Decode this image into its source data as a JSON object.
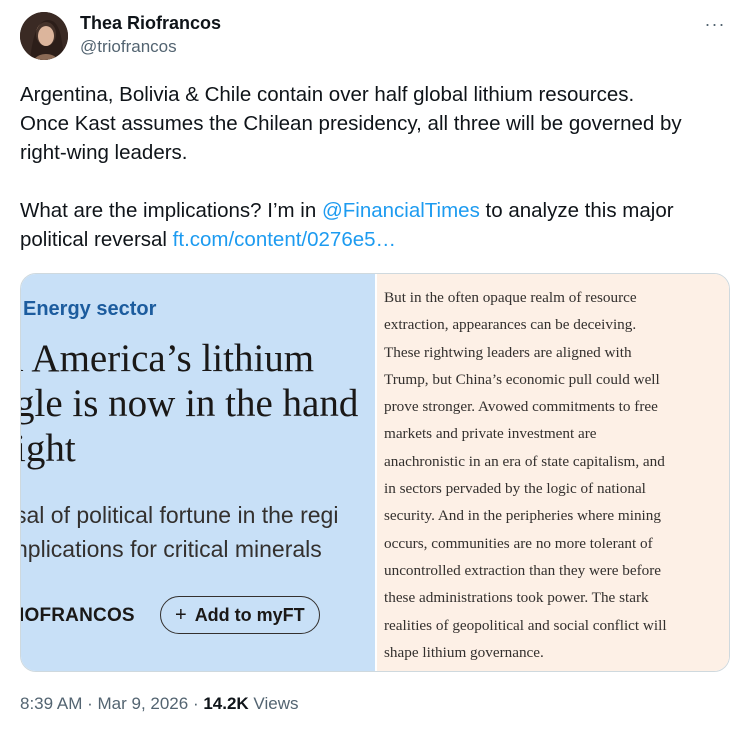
{
  "author": {
    "name": "Thea Riofrancos",
    "handle": "@triofrancos"
  },
  "more_icon": "···",
  "tweet": {
    "line1": "Argentina, Bolivia & Chile contain over half global lithium resources.",
    "line2": "Once Kast assumes the Chilean presidency, all three will be governed by",
    "line3": "right-wing leaders.",
    "line5_before": "What are the implications? I’m in ",
    "mention": "@FinancialTimes",
    "line5_after": " to analyze this major",
    "line6_before": "political reversal ",
    "link": "ft.com/content/0276e5…"
  },
  "card": {
    "left": {
      "kicker": "Energy sector",
      "headline_1": "ı America’s lithium",
      "headline_2": "gle is now in the hand",
      "headline_3": "ight",
      "standfirst_1": "sal of political fortune in the regi",
      "standfirst_2": "nplications for critical minerals",
      "byline": "IOFRANCOS",
      "myft_plus": "+",
      "myft_label": "Add to myFT"
    },
    "right": {
      "lines": [
        "But in the often opaque realm of resource",
        "extraction, appearances can be deceiving.",
        "These rightwing leaders are aligned with",
        "Trump, but China’s economic pull could well",
        "prove stronger. Avowed commitments to free",
        "markets and private investment are",
        "anachronistic in an era of state capitalism, and",
        "in sectors pervaded by the logic of national",
        "security. And in the peripheries where mining",
        "occurs, communities are no more tolerant of",
        "uncontrolled extraction than they were before",
        "these administrations took power. The stark",
        "realities of geopolitical and social conflict will",
        "shape lithium governance."
      ]
    }
  },
  "meta": {
    "time": "8:39 AM",
    "sep1": " · ",
    "date": "Mar 9, 2026",
    "sep2": " · ",
    "views_count": "14.2K",
    "views_label": " Views"
  },
  "colors": {
    "link": "#1d9bf0",
    "card_left_bg": "#c8e0f7",
    "card_right_bg": "#fdf0e6",
    "kicker": "#1c5c9e"
  }
}
